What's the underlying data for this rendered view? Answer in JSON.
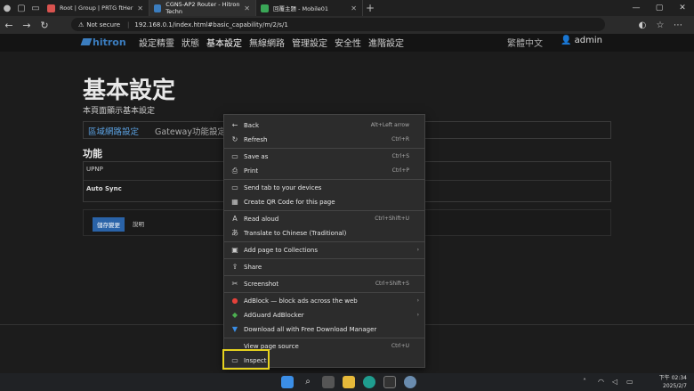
{
  "browser": {
    "tabs": [
      {
        "label": "Root | Group | PRTG ftHer",
        "active": false,
        "fav_color": "#d9534f"
      },
      {
        "label": "CGN5-AP2 Router - Hitron Techn",
        "active": true,
        "fav_color": "#3b7dbf"
      },
      {
        "label": "回覆主題 - Mobile01",
        "active": false,
        "fav_color": "#3aa757"
      }
    ],
    "new_tab": "+",
    "not_secure": "Not secure",
    "url": "192.168.0.1/index.html#basic_capability/m/2/s/1"
  },
  "router": {
    "logo": "hitron",
    "menu": [
      "設定精靈",
      "狀態",
      "基本設定",
      "無線網路",
      "管理設定",
      "安全性",
      "進階設定"
    ],
    "active_menu": "基本設定",
    "language": "繁體中文",
    "user": "admin",
    "title": "基本設定",
    "subtitle": "本頁面顯示基本設定",
    "tab_lan": "區域網路設定",
    "tab_gateway": "Gateway功能設定",
    "section": "功能",
    "row_upnp": "UPNP",
    "row_autosync": "Auto Sync",
    "save_button": "儲存變更",
    "help": "說明"
  },
  "context_menu": {
    "items": [
      {
        "label": "Back",
        "shortcut": "Alt+Left arrow",
        "icon": "←"
      },
      {
        "label": "Refresh",
        "shortcut": "Ctrl+R",
        "icon": "↻"
      },
      {
        "label": "Save as",
        "shortcut": "Ctrl+S",
        "icon": "▭"
      },
      {
        "label": "Print",
        "shortcut": "Ctrl+P",
        "icon": "⎙"
      },
      {
        "label": "Send tab to your devices",
        "shortcut": "",
        "icon": "▭"
      },
      {
        "label": "Create QR Code for this page",
        "shortcut": "",
        "icon": "▦"
      },
      {
        "label": "Read aloud",
        "shortcut": "Ctrl+Shift+U",
        "icon": "A"
      },
      {
        "label": "Translate to Chinese (Traditional)",
        "shortcut": "",
        "icon": "あ"
      },
      {
        "label": "Add page to Collections",
        "shortcut": "",
        "icon": "▣",
        "arrow": "›"
      },
      {
        "label": "Share",
        "shortcut": "",
        "icon": "⇪"
      },
      {
        "label": "Screenshot",
        "shortcut": "Ctrl+Shift+S",
        "icon": "✂"
      },
      {
        "label": "AdBlock — block ads across the web",
        "shortcut": "",
        "icon": "●",
        "arrow": "›"
      },
      {
        "label": "AdGuard AdBlocker",
        "shortcut": "",
        "icon": "◆",
        "arrow": "›"
      },
      {
        "label": "Download all with Free Download Manager",
        "shortcut": "",
        "icon": "▼"
      },
      {
        "label": "View page source",
        "shortcut": "Ctrl+U",
        "icon": ""
      },
      {
        "label": "Inspect",
        "shortcut": "",
        "icon": "▭"
      }
    ],
    "highlight_color": "#e6d21f"
  },
  "taskbar": {
    "time": "下午 02:34",
    "date": "2025/2/7"
  }
}
